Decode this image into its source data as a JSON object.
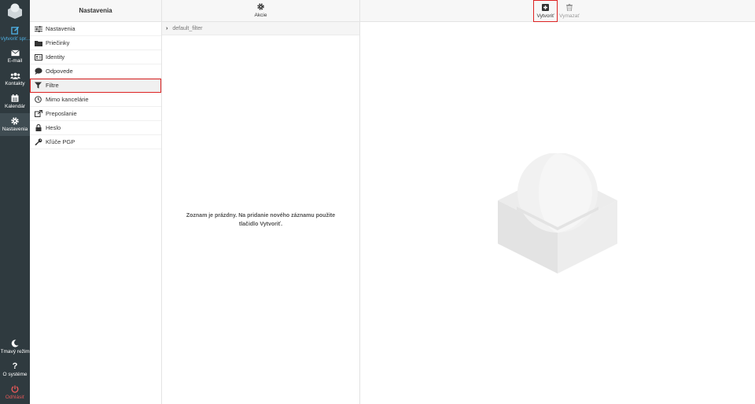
{
  "rail": {
    "compose_label": "Vytvoriť spr...",
    "items": [
      {
        "label": "E-mail",
        "icon": "envelope-icon"
      },
      {
        "label": "Kontakty",
        "icon": "users-icon"
      },
      {
        "label": "Kalendár",
        "icon": "calendar-icon"
      },
      {
        "label": "Nastavenia",
        "icon": "gear-icon"
      }
    ],
    "bottom": [
      {
        "label": "Tmavý režim",
        "icon": "moon-icon"
      },
      {
        "label": "O systéme",
        "icon": "question-icon"
      },
      {
        "label": "Odhlásiť",
        "icon": "power-icon"
      }
    ]
  },
  "settings": {
    "title": "Nastavenia",
    "items": [
      {
        "label": "Nastavenia",
        "icon": "sliders-icon"
      },
      {
        "label": "Priečinky",
        "icon": "folder-icon"
      },
      {
        "label": "Identity",
        "icon": "id-card-icon"
      },
      {
        "label": "Odpovede",
        "icon": "comment-icon"
      },
      {
        "label": "Filtre",
        "icon": "filter-icon"
      },
      {
        "label": "Mimo kancelárie",
        "icon": "clock-icon"
      },
      {
        "label": "Preposlanie",
        "icon": "forward-icon"
      },
      {
        "label": "Heslo",
        "icon": "lock-icon"
      },
      {
        "label": "Kľúče PGP",
        "icon": "key-icon"
      }
    ],
    "selected": "Filtre"
  },
  "filters": {
    "actions_label": "Akcie",
    "filter_set": "default_filter",
    "empty_message": "Zoznam je prázdny. Na pridanie nového záznamu použite tlačidlo Vytvoriť."
  },
  "detail": {
    "create_label": "Vytvoriť",
    "delete_label": "Vymazať"
  },
  "colors": {
    "rail_bg": "#2f3a3f",
    "accent": "#4fb3e8",
    "logout": "#e25858",
    "highlight": "#dd2222"
  }
}
